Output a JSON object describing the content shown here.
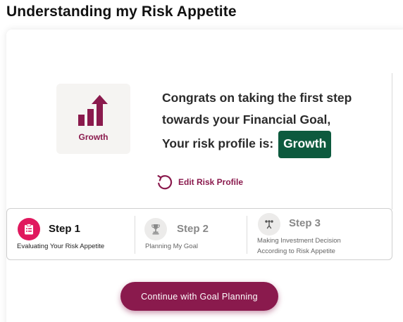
{
  "page": {
    "title": "Understanding my Risk Appetite"
  },
  "profile": {
    "icon": "growth-bars-arrow-icon",
    "tile_label": "Growth",
    "congrats_line1": "Congrats on taking the first step",
    "congrats_line2": "towards your Financial Goal,",
    "congrats_line3": "Your risk profile is:",
    "risk_value": "Growth"
  },
  "edit": {
    "icon": "refresh-icon",
    "label": "Edit Risk Profile"
  },
  "steps": [
    {
      "title": "Step 1",
      "subtitle": "Evaluating Your Risk Appetite",
      "icon": "clipboard-icon",
      "active": true
    },
    {
      "title": "Step 2",
      "subtitle": "Planning My Goal",
      "icon": "trophy-icon",
      "active": false
    },
    {
      "title": "Step 3",
      "subtitle_line1": "Making Investment Decision",
      "subtitle_line2": "According to Risk Appetite",
      "icon": "decision-icon",
      "active": false
    }
  ],
  "continue_button": {
    "label": "Continue with Goal Planning"
  },
  "colors": {
    "brand": "#8a1a4d",
    "active_step_icon": "#e0185e",
    "risk_badge": "#0d5a3e",
    "tile_bg": "#f5f4f2"
  }
}
